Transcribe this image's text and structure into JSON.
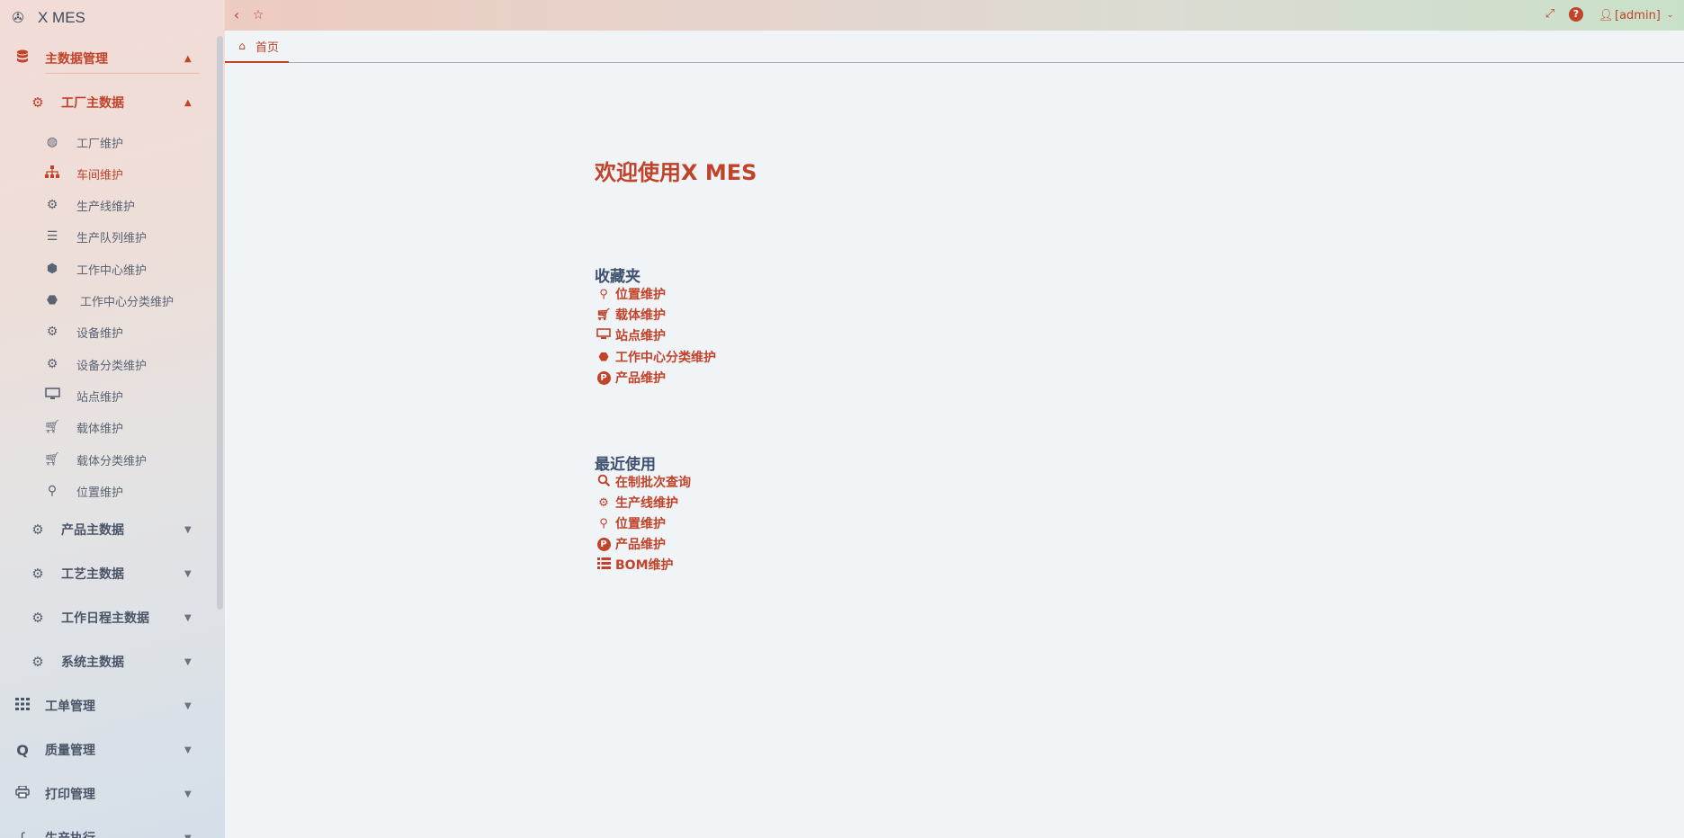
{
  "app": {
    "title": "X MES"
  },
  "sidebar": {
    "groups": [
      {
        "label": "主数据管理",
        "icon": "database-icon"
      },
      {
        "label": "工单管理",
        "icon": "grid-icon"
      },
      {
        "label": "质量管理",
        "icon": "q-icon"
      },
      {
        "label": "打印管理",
        "icon": "print-icon"
      },
      {
        "label": "生产执行",
        "icon": "feather-icon"
      }
    ],
    "subgroups": [
      {
        "label": "工厂主数据"
      },
      {
        "label": "产品主数据"
      },
      {
        "label": "工艺主数据"
      },
      {
        "label": "工作日程主数据"
      },
      {
        "label": "系统主数据"
      }
    ],
    "items": [
      {
        "label": "工厂维护",
        "icon": "globe-icon"
      },
      {
        "label": "车间维护",
        "icon": "sitemap-icon"
      },
      {
        "label": "生产线维护",
        "icon": "cogs-icon"
      },
      {
        "label": "生产队列维护",
        "icon": "list-icon"
      },
      {
        "label": "工作中心维护",
        "icon": "cube-icon"
      },
      {
        "label": "工作中心分类维护",
        "icon": "cubes-icon"
      },
      {
        "label": "设备维护",
        "icon": "gear-icon"
      },
      {
        "label": "设备分类维护",
        "icon": "cogs-icon"
      },
      {
        "label": "站点维护",
        "icon": "desktop-icon"
      },
      {
        "label": "载体维护",
        "icon": "cart-icon"
      },
      {
        "label": "载体分类维护",
        "icon": "cart-plus-icon"
      },
      {
        "label": "位置维护",
        "icon": "map-marker-icon"
      }
    ]
  },
  "topbar": {
    "user_label": "[admin]"
  },
  "tabs": [
    {
      "label": "首页"
    }
  ],
  "main": {
    "welcome": "欢迎使用X MES",
    "favorites": {
      "title": "收藏夹",
      "links": [
        {
          "label": "位置维护",
          "icon": "map-marker-icon"
        },
        {
          "label": "载体维护",
          "icon": "cart-icon"
        },
        {
          "label": "站点维护",
          "icon": "desktop-icon"
        },
        {
          "label": "工作中心分类维护",
          "icon": "cubes-icon"
        },
        {
          "label": "产品维护",
          "icon": "product-p-icon"
        }
      ]
    },
    "recent": {
      "title": "最近使用",
      "links": [
        {
          "label": "在制批次查询",
          "icon": "search-icon"
        },
        {
          "label": "生产线维护",
          "icon": "cogs-icon"
        },
        {
          "label": "位置维护",
          "icon": "map-marker-icon"
        },
        {
          "label": "产品维护",
          "icon": "product-p-icon"
        },
        {
          "label": "BOM维护",
          "icon": "table-list-icon"
        }
      ]
    }
  },
  "colors": {
    "accent": "#c0432a",
    "text": "#4a5568",
    "background": "#f0f4f7"
  }
}
